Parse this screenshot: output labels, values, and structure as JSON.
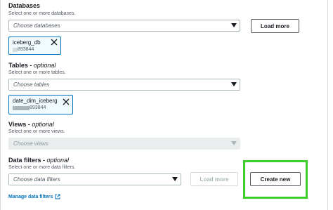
{
  "databases": {
    "label": "Databases",
    "description": "Select one or more databases.",
    "select_placeholder": "Choose databases",
    "load_more_label": "Load more",
    "selected_token": {
      "name": "iceberg_db",
      "sub": "893844"
    }
  },
  "tables": {
    "label": "Tables",
    "optional": "optional",
    "description": "Select one or more tables.",
    "select_placeholder": "Choose tables",
    "selected_token": {
      "name": "date_dim_iceberg",
      "sub": "893844"
    }
  },
  "views": {
    "label": "Views",
    "optional": "optional",
    "description": "Select one or more views.",
    "select_placeholder": "Choose views"
  },
  "data_filters": {
    "label": "Data filters",
    "optional": "optional",
    "description": "Select one or more data filters.",
    "select_placeholder": "Choose data filters",
    "load_more_label": "Load more",
    "create_new_label": "Create new",
    "manage_link_label": "Manage data filters"
  },
  "colors": {
    "link": "#0073bb",
    "highlight": "#3ecf2c",
    "token_border": "#0073bb",
    "token_bg": "#f1faff"
  },
  "icons": [
    "caret-down-icon",
    "close-icon",
    "external-link-icon"
  ]
}
